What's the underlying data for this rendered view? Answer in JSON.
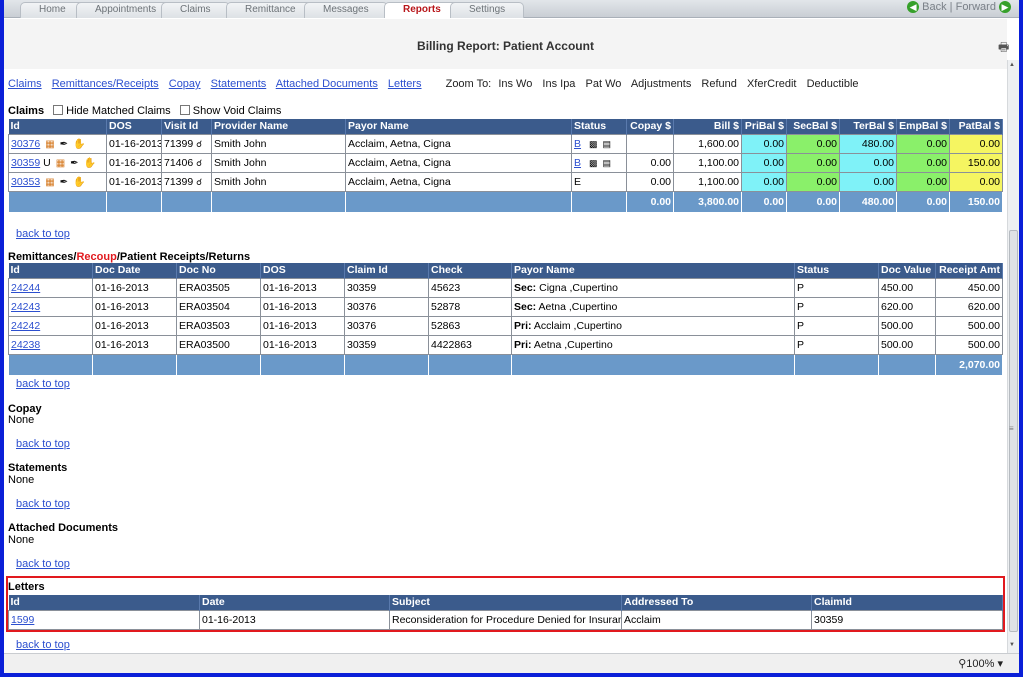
{
  "tabs": [
    "Home",
    "Appointments",
    "Claims",
    "Remittance",
    "Messages",
    "Reports",
    "Settings"
  ],
  "active_tab": "Reports",
  "nav": {
    "back": "Back",
    "sep": "|",
    "forward": "Forward"
  },
  "page_title": "Billing Report: Patient Account",
  "top_links": [
    "Claims",
    "Remittances/Receipts",
    "Copay",
    "Statements",
    "Attached Documents",
    "Letters"
  ],
  "zoom_to": {
    "label": "Zoom To:",
    "items": [
      "Ins Wo",
      "Ins Ipa",
      "Pat Wo",
      "Adjustments",
      "Refund",
      "XferCredit",
      "Deductible"
    ]
  },
  "claims": {
    "label": "Claims",
    "options": [
      "Hide Matched Claims",
      "Show Void Claims"
    ],
    "headers": [
      "Id",
      "DOS",
      "Visit Id",
      "Provider Name",
      "Payor Name",
      "Status",
      "Copay $",
      "Bill $",
      "PriBal $",
      "SecBal $",
      "TerBal $",
      "EmpBal $",
      "PatBal $"
    ],
    "rows": [
      {
        "id": "30376",
        "flag": "",
        "dos": "01-16-2013",
        "visit": "71399",
        "provider": "Smith John",
        "payor": "Acclaim, Aetna, Cigna",
        "status": "B",
        "copay": "",
        "bill": "1,600.00",
        "pri": "0.00",
        "sec": "0.00",
        "ter": "480.00",
        "emp": "0.00",
        "pat": "0.00"
      },
      {
        "id": "30359",
        "flag": "U",
        "dos": "01-16-2013",
        "visit": "71406",
        "provider": "Smith John",
        "payor": "Acclaim, Aetna, Cigna",
        "status": "B",
        "copay": "0.00",
        "bill": "1,100.00",
        "pri": "0.00",
        "sec": "0.00",
        "ter": "0.00",
        "emp": "0.00",
        "pat": "150.00"
      },
      {
        "id": "30353",
        "flag": "",
        "dos": "01-16-2013",
        "visit": "71399",
        "provider": "Smith John",
        "payor": "Acclaim, Aetna, Cigna",
        "status": "E",
        "copay": "0.00",
        "bill": "1,100.00",
        "pri": "0.00",
        "sec": "0.00",
        "ter": "0.00",
        "emp": "0.00",
        "pat": "0.00"
      }
    ],
    "totals": {
      "copay": "0.00",
      "bill": "3,800.00",
      "pri": "0.00",
      "sec": "0.00",
      "ter": "480.00",
      "emp": "0.00",
      "pat": "150.00"
    }
  },
  "back_to_top": "back to top",
  "remit": {
    "label_a": "Remittances/",
    "label_b": "Recoup",
    "label_c": "/Patient Receipts/Returns",
    "headers": [
      "Id",
      "Doc Date",
      "Doc No",
      "DOS",
      "Claim Id",
      "Check",
      "Payor Name",
      "Status",
      "Doc Value",
      "Receipt Amt"
    ],
    "rows": [
      {
        "id": "24244",
        "docdate": "01-16-2013",
        "docno": "ERA03505",
        "dos": "01-16-2013",
        "claim": "30359",
        "check": "45623",
        "prefix": "Sec:",
        "payor": "Cigna ,Cupertino",
        "status": "P",
        "docval": "450.00",
        "receipt": "450.00"
      },
      {
        "id": "24243",
        "docdate": "01-16-2013",
        "docno": "ERA03504",
        "dos": "01-16-2013",
        "claim": "30376",
        "check": "52878",
        "prefix": "Sec:",
        "payor": "Aetna ,Cupertino",
        "status": "P",
        "docval": "620.00",
        "receipt": "620.00"
      },
      {
        "id": "24242",
        "docdate": "01-16-2013",
        "docno": "ERA03503",
        "dos": "01-16-2013",
        "claim": "30376",
        "check": "52863",
        "prefix": "Pri:",
        "payor": "Acclaim ,Cupertino",
        "status": "P",
        "docval": "500.00",
        "receipt": "500.00"
      },
      {
        "id": "24238",
        "docdate": "01-16-2013",
        "docno": "ERA03500",
        "dos": "01-16-2013",
        "claim": "30359",
        "check": "4422863",
        "prefix": "Pri:",
        "payor": "Aetna ,Cupertino",
        "status": "P",
        "docval": "500.00",
        "receipt": "500.00"
      }
    ],
    "total": "2,070.00"
  },
  "copay": {
    "label": "Copay",
    "value": "None"
  },
  "statements": {
    "label": "Statements",
    "value": "None"
  },
  "attached": {
    "label": "Attached Documents",
    "value": "None"
  },
  "letters": {
    "label": "Letters",
    "headers": [
      "Id",
      "Date",
      "Subject",
      "Addressed To",
      "ClaimId"
    ],
    "rows": [
      {
        "id": "1599",
        "date": "01-16-2013",
        "subject": "Reconsideration for Procedure Denied for Insurance",
        "to": "Acclaim",
        "claim": "30359"
      }
    ]
  },
  "zoom_level": "100%",
  "colors": {
    "header": "#3b5b8c",
    "footer": "#6a99c9",
    "pri": "#7ff2f8",
    "sec": "#8af06a",
    "pat": "#f5f561",
    "link": "#2c4fcf",
    "highlight": "#e1191e"
  },
  "icons": [
    "printer-icon",
    "document-icon",
    "phone-icon",
    "hand-icon",
    "stethoscope-icon",
    "scan-icon",
    "barcode-icon"
  ]
}
